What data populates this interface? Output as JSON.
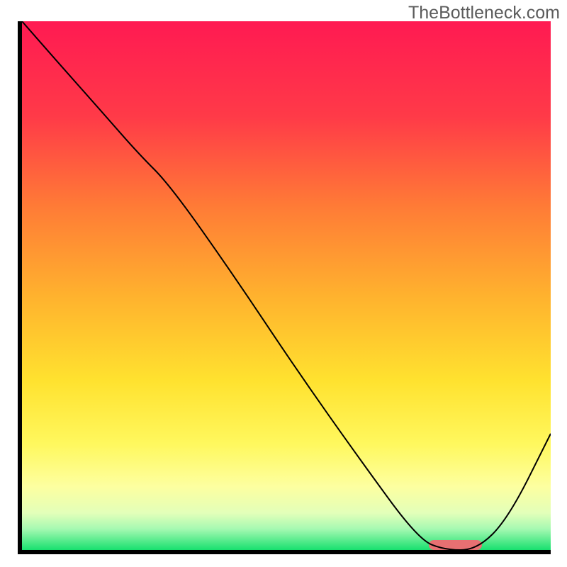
{
  "watermark": "TheBottleneck.com",
  "chart_data": {
    "type": "line",
    "title": "",
    "xlabel": "",
    "ylabel": "",
    "xlim": [
      0,
      100
    ],
    "ylim": [
      0,
      100
    ],
    "series": [
      {
        "name": "bottleneck-curve",
        "x": [
          0,
          7,
          15,
          22,
          28,
          40,
          52,
          64,
          75,
          80,
          86,
          92,
          100
        ],
        "values": [
          100,
          92,
          83,
          75,
          69,
          52,
          34,
          17,
          2,
          0,
          0,
          6,
          22
        ]
      }
    ],
    "marker": {
      "x_start": 77,
      "x_end": 87,
      "y": 0
    },
    "gradient_stops": [
      {
        "offset": 0,
        "color": "#ff1a52"
      },
      {
        "offset": 18,
        "color": "#ff3a48"
      },
      {
        "offset": 35,
        "color": "#ff7b36"
      },
      {
        "offset": 52,
        "color": "#ffb22e"
      },
      {
        "offset": 68,
        "color": "#ffe22f"
      },
      {
        "offset": 80,
        "color": "#fff85e"
      },
      {
        "offset": 88,
        "color": "#fdffa0"
      },
      {
        "offset": 93,
        "color": "#e3ffb9"
      },
      {
        "offset": 96,
        "color": "#a6f9b2"
      },
      {
        "offset": 100,
        "color": "#18e06f"
      }
    ]
  }
}
